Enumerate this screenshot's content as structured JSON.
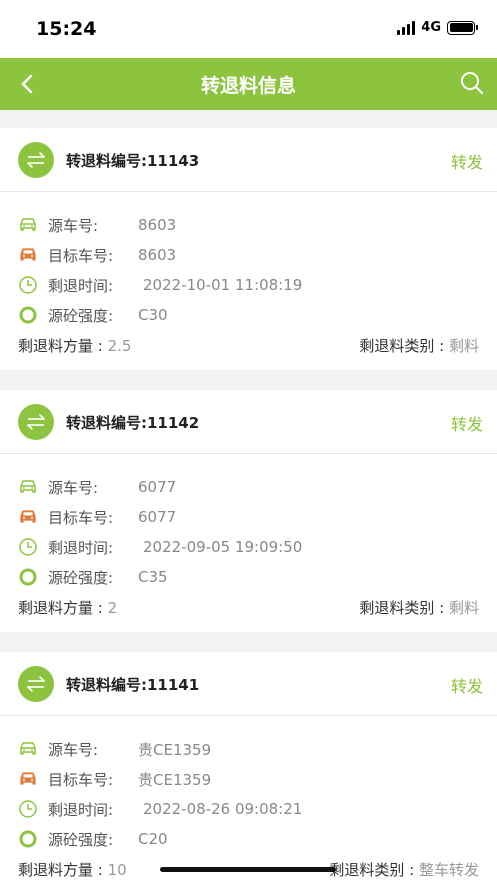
{
  "status": {
    "time": "15:24",
    "network": "4G"
  },
  "nav": {
    "title": "转退料信息"
  },
  "labels": {
    "source_vehicle": "源车号:",
    "target_vehicle": "目标车号:",
    "return_time": "剩退时间:",
    "source_strength": "源砼强度:",
    "quantity": "剩退料方量 : ",
    "category": "剩退料类别 : "
  },
  "cards": [
    {
      "title": "转退料编号:11143",
      "action": "转发",
      "source_vehicle": "8603",
      "target_vehicle": "8603",
      "return_time": "2022-10-01 11:08:19",
      "source_strength": "C30",
      "quantity": "2.5",
      "category": "剩料"
    },
    {
      "title": "转退料编号:11142",
      "action": "转发",
      "source_vehicle": "6077",
      "target_vehicle": "6077",
      "return_time": "2022-09-05 19:09:50",
      "source_strength": "C35",
      "quantity": "2",
      "category": "剩料"
    },
    {
      "title": "转退料编号:11141",
      "action": "转发",
      "source_vehicle": "贵CE1359",
      "target_vehicle": "贵CE1359",
      "return_time": "2022-08-26 09:08:21",
      "source_strength": "C20",
      "quantity": "10",
      "category": "整车转发"
    }
  ],
  "colors": {
    "brand": "#8cc43f",
    "target_car": "#e07b39"
  }
}
